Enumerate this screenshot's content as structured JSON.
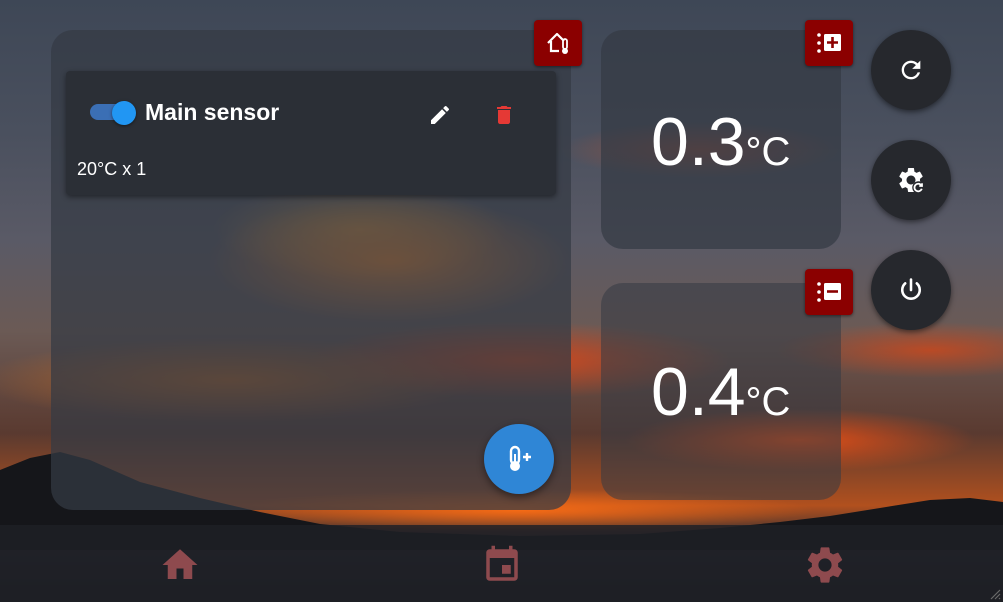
{
  "sensor": {
    "name": "Main sensor",
    "detail": "20°C x 1",
    "enabled": true
  },
  "temperatures": {
    "increase": {
      "value": "0.3",
      "unit": "°C"
    },
    "decrease": {
      "value": "0.4",
      "unit": "°C"
    }
  },
  "icons": {
    "home_thermostat": "home-thermometer-icon",
    "increase": "increase-list-icon",
    "decrease": "decrease-list-icon",
    "edit": "pencil-icon",
    "delete": "trash-icon",
    "add_sensor": "thermometer-plus-icon",
    "refresh": "refresh-icon",
    "settings_refresh": "gear-refresh-icon",
    "power": "power-icon",
    "nav_home": "home-icon",
    "nav_calendar": "calendar-icon",
    "nav_settings": "gear-icon"
  },
  "colors": {
    "badge": "#8b0000",
    "accent": "#2196f3",
    "delete": "#e53935",
    "nav": "#8e4a4e"
  }
}
